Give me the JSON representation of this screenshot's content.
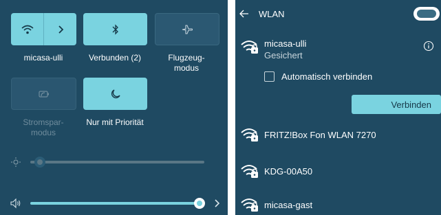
{
  "quick_settings": {
    "tiles": [
      {
        "label": "micasa-ulli",
        "state": "on"
      },
      {
        "label": "Verbunden (2)",
        "state": "on"
      },
      {
        "label": "Flugzeug-\nmodus",
        "state": "off"
      },
      {
        "label": "Stromspar-\nmodus",
        "state": "disabled"
      },
      {
        "label": "Nur mit Priorität",
        "state": "on"
      }
    ],
    "brightness_level": 0.03,
    "volume_level": 1.0
  },
  "wlan": {
    "title": "WLAN",
    "toggle_on": true,
    "selected": {
      "name": "micasa-ulli",
      "status": "Gesichert",
      "auto_connect_label": "Automatisch verbinden",
      "auto_connect_checked": false,
      "connect_label": "Verbinden"
    },
    "networks": [
      {
        "name": "FRITZ!Box Fon WLAN 7270"
      },
      {
        "name": "KDG-00A50"
      },
      {
        "name": "micasa-gast"
      }
    ]
  },
  "colors": {
    "panel": "#1f4a62",
    "accent": "#7ad3e0"
  }
}
